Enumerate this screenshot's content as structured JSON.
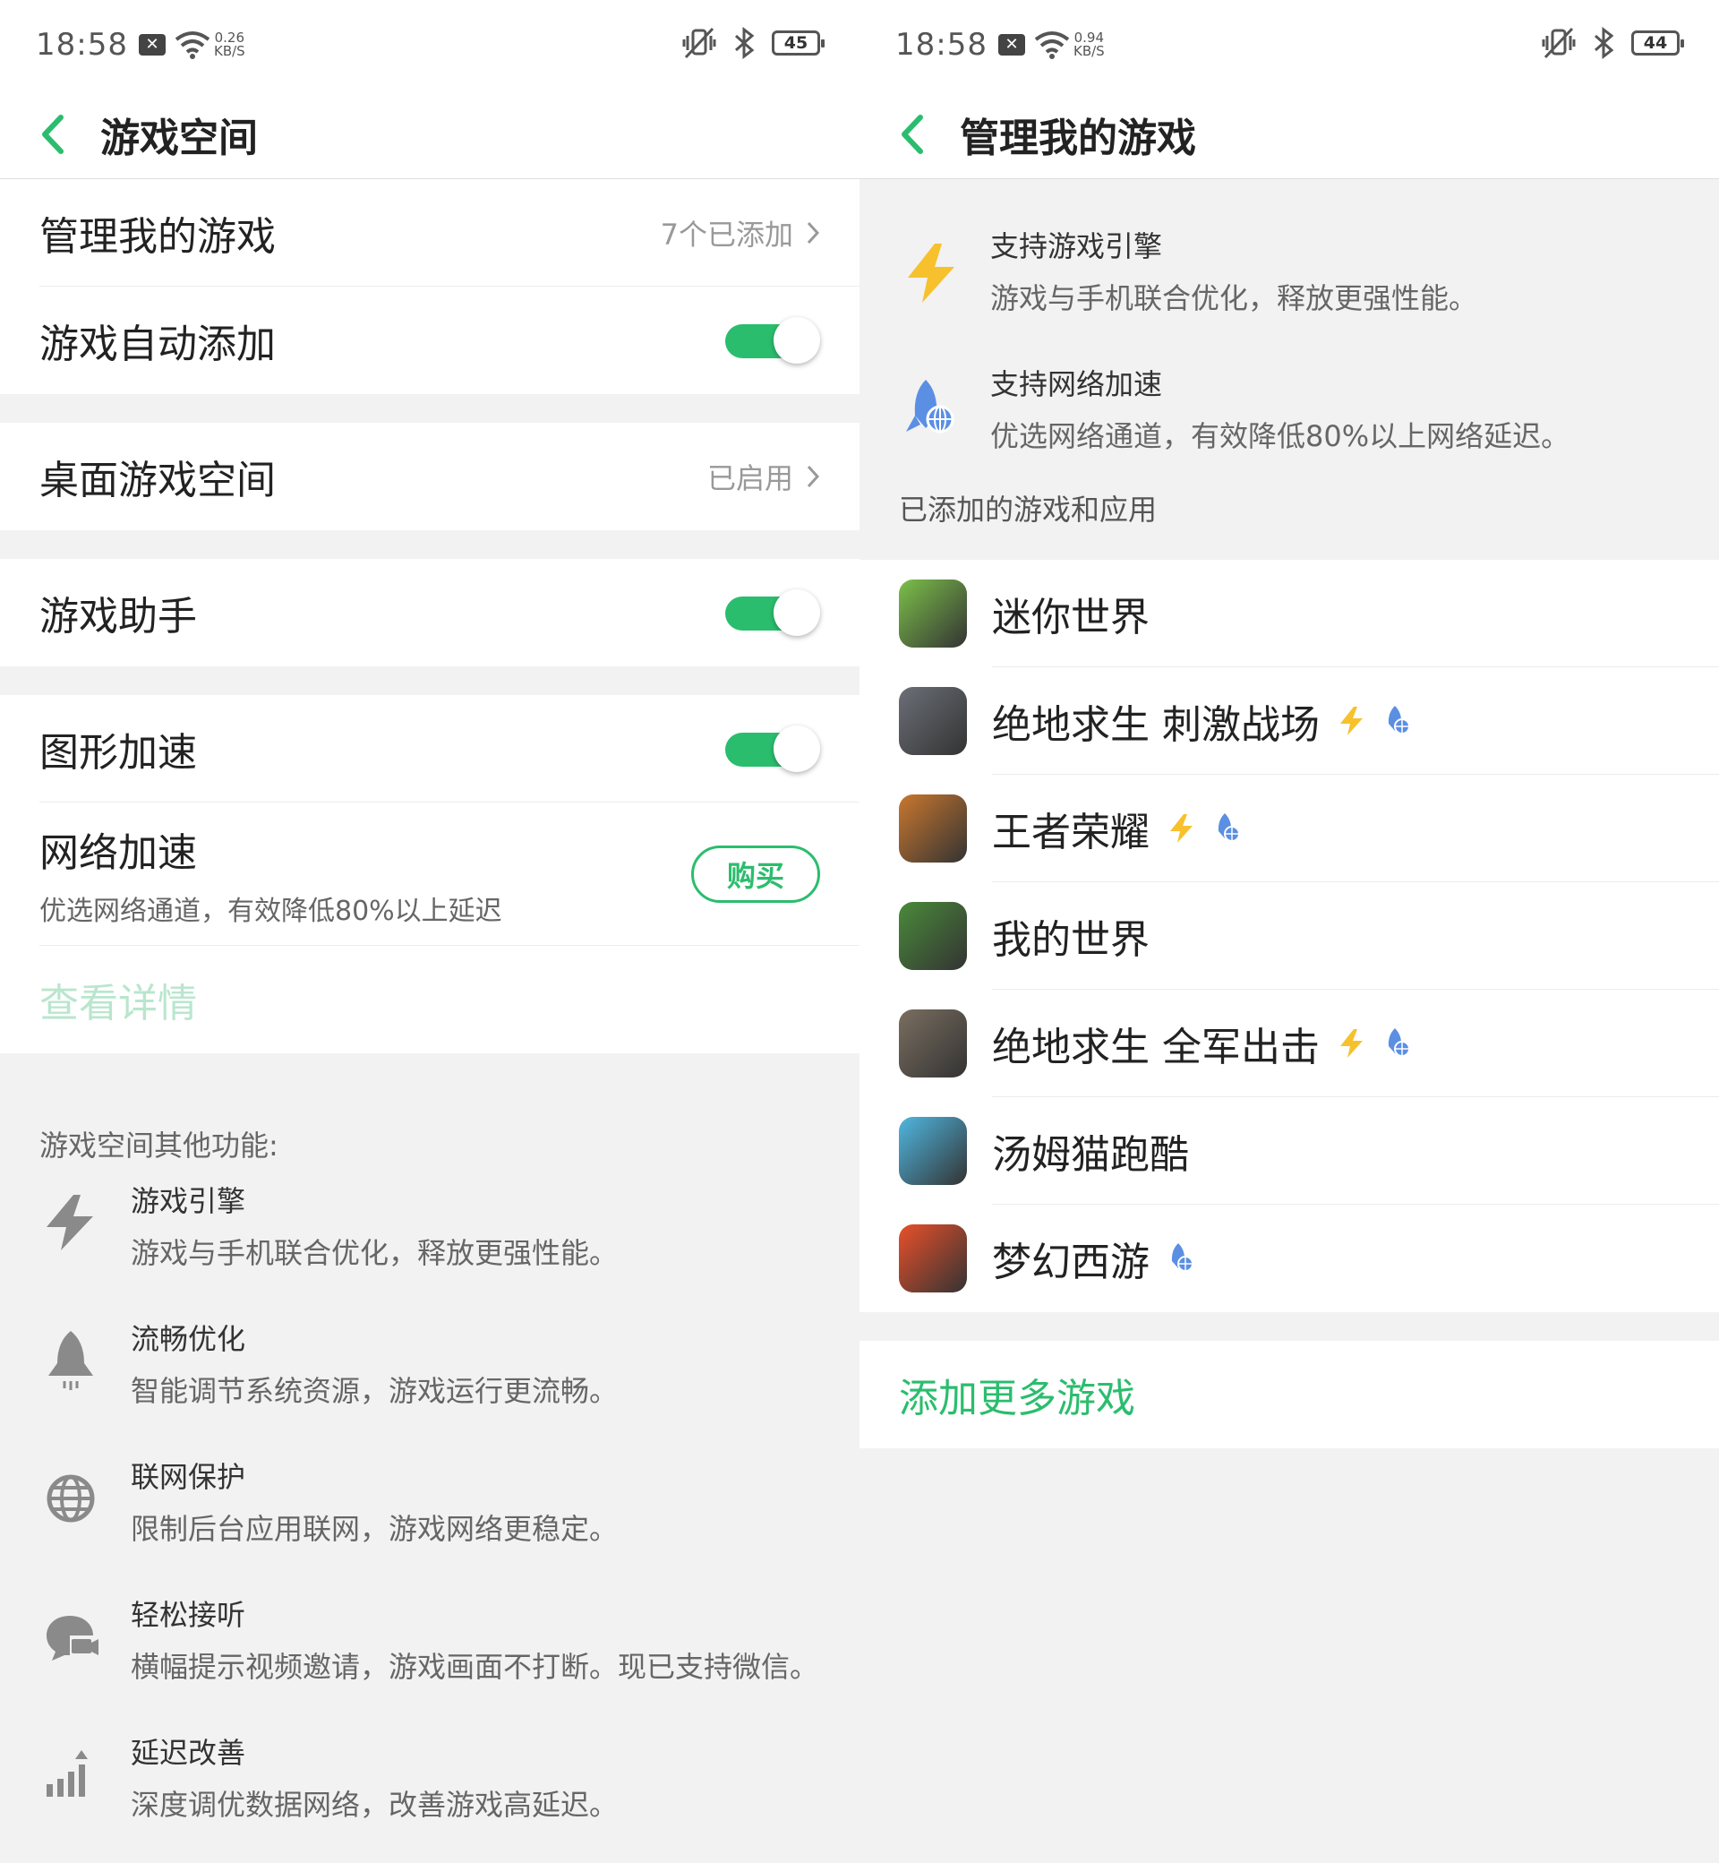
{
  "left": {
    "status": {
      "time": "18:58",
      "speed_value": "0.26",
      "speed_unit": "KB/S",
      "battery": "45"
    },
    "header": {
      "title": "游戏空间"
    },
    "settings": {
      "manage_games": {
        "label": "管理我的游戏",
        "value": "7个已添加"
      },
      "auto_add": {
        "label": "游戏自动添加",
        "on": true
      },
      "desktop_space": {
        "label": "桌面游戏空间",
        "value": "已启用"
      },
      "assistant": {
        "label": "游戏助手",
        "on": true
      },
      "graphics_accel": {
        "label": "图形加速",
        "on": true
      },
      "network_accel": {
        "label": "网络加速",
        "desc": "优选网络通道，有效降低80%以上延迟",
        "button": "购买"
      },
      "details_link": "查看详情"
    },
    "other_section_title": "游戏空间其他功能:",
    "features": [
      {
        "icon": "lightning-icon",
        "title": "游戏引擎",
        "desc": "游戏与手机联合优化，释放更强性能。"
      },
      {
        "icon": "rocket-icon",
        "title": "流畅优化",
        "desc": "智能调节系统资源，游戏运行更流畅。"
      },
      {
        "icon": "globe-icon",
        "title": "联网保护",
        "desc": "限制后台应用联网，游戏网络更稳定。"
      },
      {
        "icon": "chat-bubble-icon",
        "title": "轻松接听",
        "desc": "横幅提示视频邀请，游戏画面不打断。现已支持微信。"
      },
      {
        "icon": "signal-up-icon",
        "title": "延迟改善",
        "desc": "深度调优数据网络，改善游戏高延迟。"
      }
    ]
  },
  "right": {
    "status": {
      "time": "18:58",
      "speed_value": "0.94",
      "speed_unit": "KB/S",
      "battery": "44"
    },
    "header": {
      "title": "管理我的游戏"
    },
    "supports": [
      {
        "icon": "lightning-icon",
        "title": "支持游戏引擎",
        "desc": "游戏与手机联合优化，释放更强性能。"
      },
      {
        "icon": "rocket-globe-icon",
        "title": "支持网络加速",
        "desc": "优选网络通道，有效降低80%以上网络延迟。"
      }
    ],
    "list_caption": "已添加的游戏和应用",
    "games": [
      {
        "name": "迷你世界",
        "engine": false,
        "network": false,
        "color": "#7cc04a"
      },
      {
        "name": "绝地求生 刺激战场",
        "engine": true,
        "network": true,
        "color": "#6b6f77"
      },
      {
        "name": "王者荣耀",
        "engine": true,
        "network": true,
        "color": "#c9772e"
      },
      {
        "name": "我的世界",
        "engine": false,
        "network": false,
        "color": "#4a8a3a"
      },
      {
        "name": "绝地求生 全军出击",
        "engine": true,
        "network": true,
        "color": "#7a6e60"
      },
      {
        "name": "汤姆猫跑酷",
        "engine": false,
        "network": false,
        "color": "#4fb7e0"
      },
      {
        "name": "梦幻西游",
        "engine": false,
        "network": true,
        "color": "#e8502a"
      }
    ],
    "add_more": "添加更多游戏"
  },
  "colors": {
    "accent": "#2bbd6e",
    "engine": "#f6c12c",
    "network": "#5b8fe3"
  }
}
